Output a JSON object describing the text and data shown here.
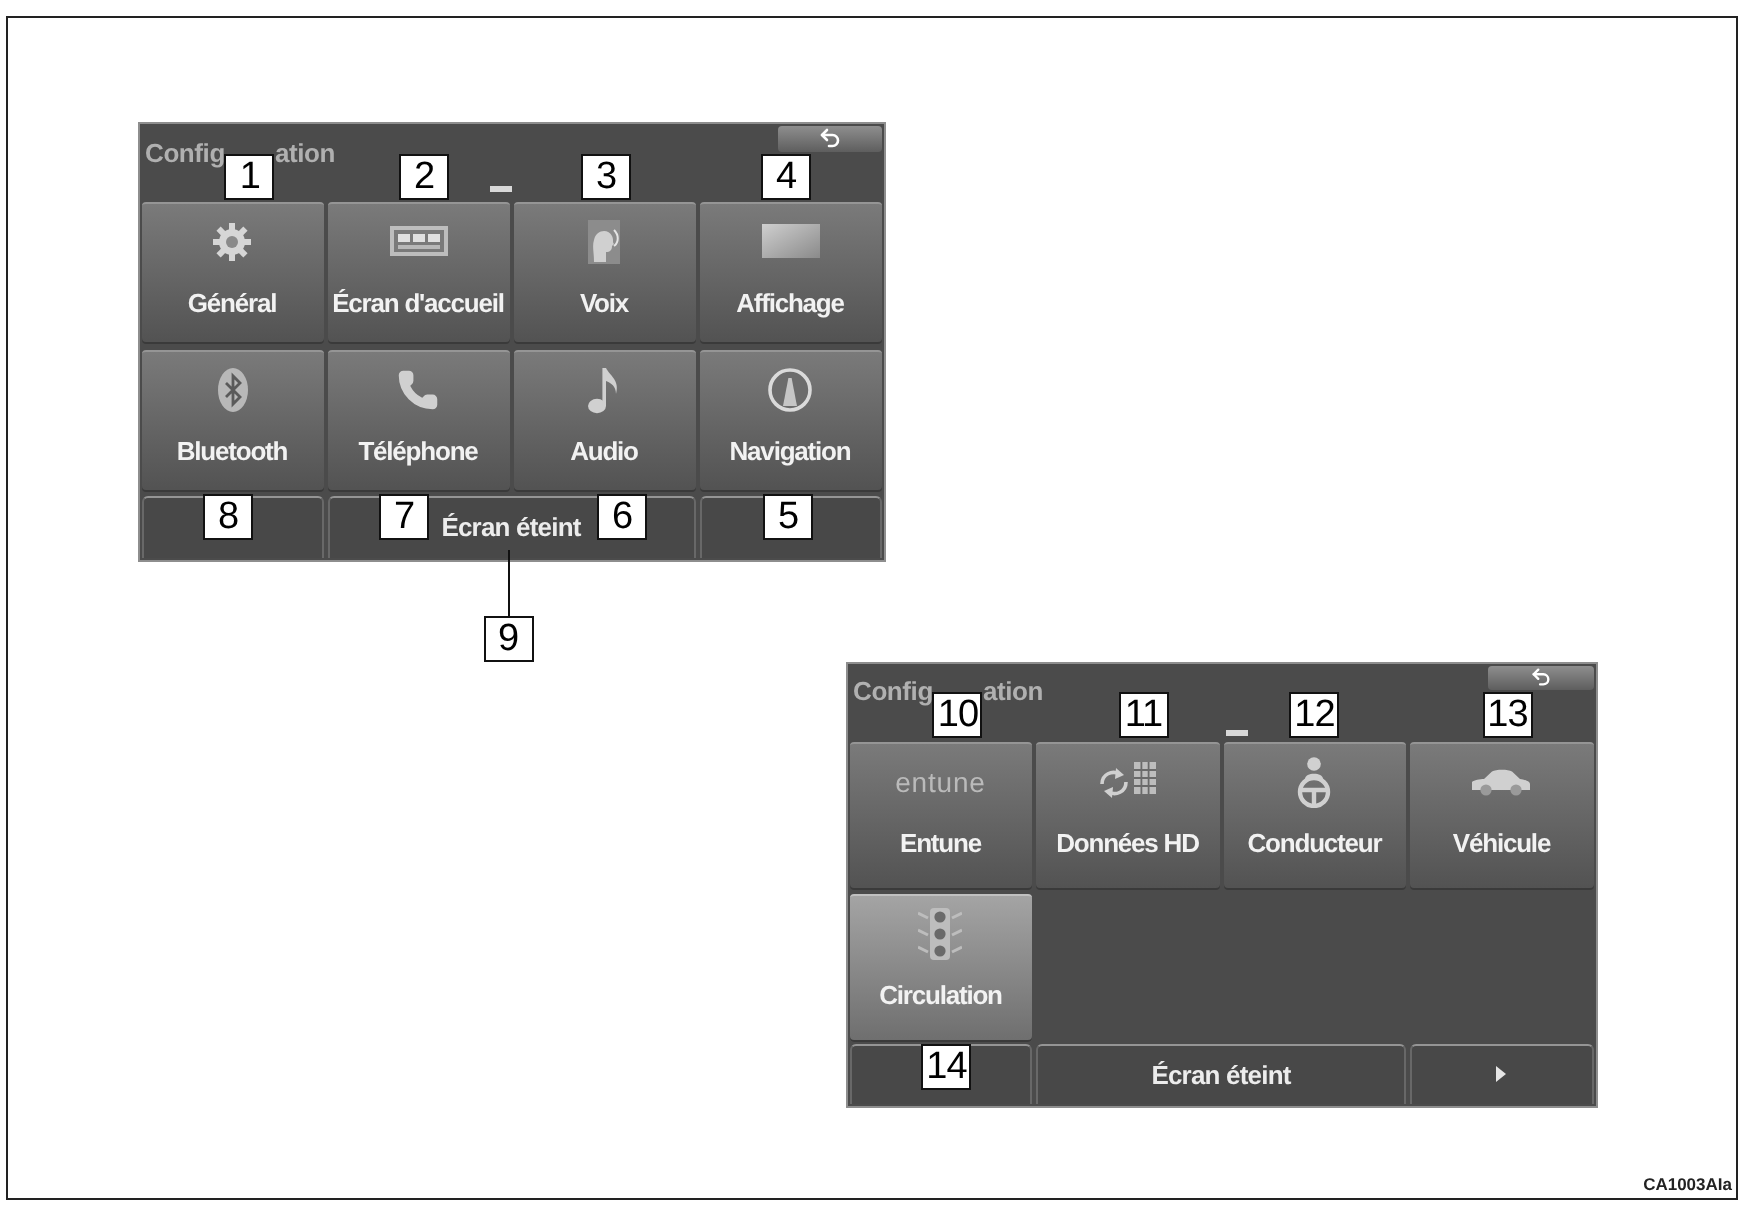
{
  "screens": [
    {
      "title_fragments": [
        "Config",
        "ation"
      ],
      "buttons": [
        {
          "label": "Général",
          "callout": "1",
          "selected": false
        },
        {
          "label": "Écran d'accueil",
          "callout": "2",
          "selected": false
        },
        {
          "label": "Voix",
          "callout": "3",
          "selected": false
        },
        {
          "label": "Affichage",
          "callout": "4",
          "selected": false
        },
        {
          "label": "Bluetooth",
          "callout": "8",
          "selected": false
        },
        {
          "label": "Téléphone",
          "callout": "7",
          "selected": false
        },
        {
          "label": "Audio",
          "callout": "6",
          "selected": false
        },
        {
          "label": "Navigation",
          "callout": "5",
          "selected": false
        }
      ],
      "bar": [
        {
          "kind": "blank"
        },
        {
          "kind": "label",
          "text": "Écran éteint",
          "callout": "9"
        },
        {
          "kind": "blank"
        }
      ]
    },
    {
      "title_fragments": [
        "Config",
        "ation"
      ],
      "buttons": [
        {
          "label": "Entune",
          "logo": "entune",
          "callout": "10",
          "selected": false
        },
        {
          "label": "Données HD",
          "callout": "11",
          "selected": false
        },
        {
          "label": "Conducteur",
          "callout": "12",
          "selected": false
        },
        {
          "label": "Véhicule",
          "callout": "13",
          "selected": false
        },
        {
          "label": "Circulation",
          "callout": "14",
          "selected": true
        }
      ],
      "bar": [
        {
          "kind": "blank"
        },
        {
          "kind": "label",
          "text": "Écran éteint"
        },
        {
          "kind": "arrow"
        }
      ]
    }
  ],
  "figure_code": "CA1003AIa"
}
